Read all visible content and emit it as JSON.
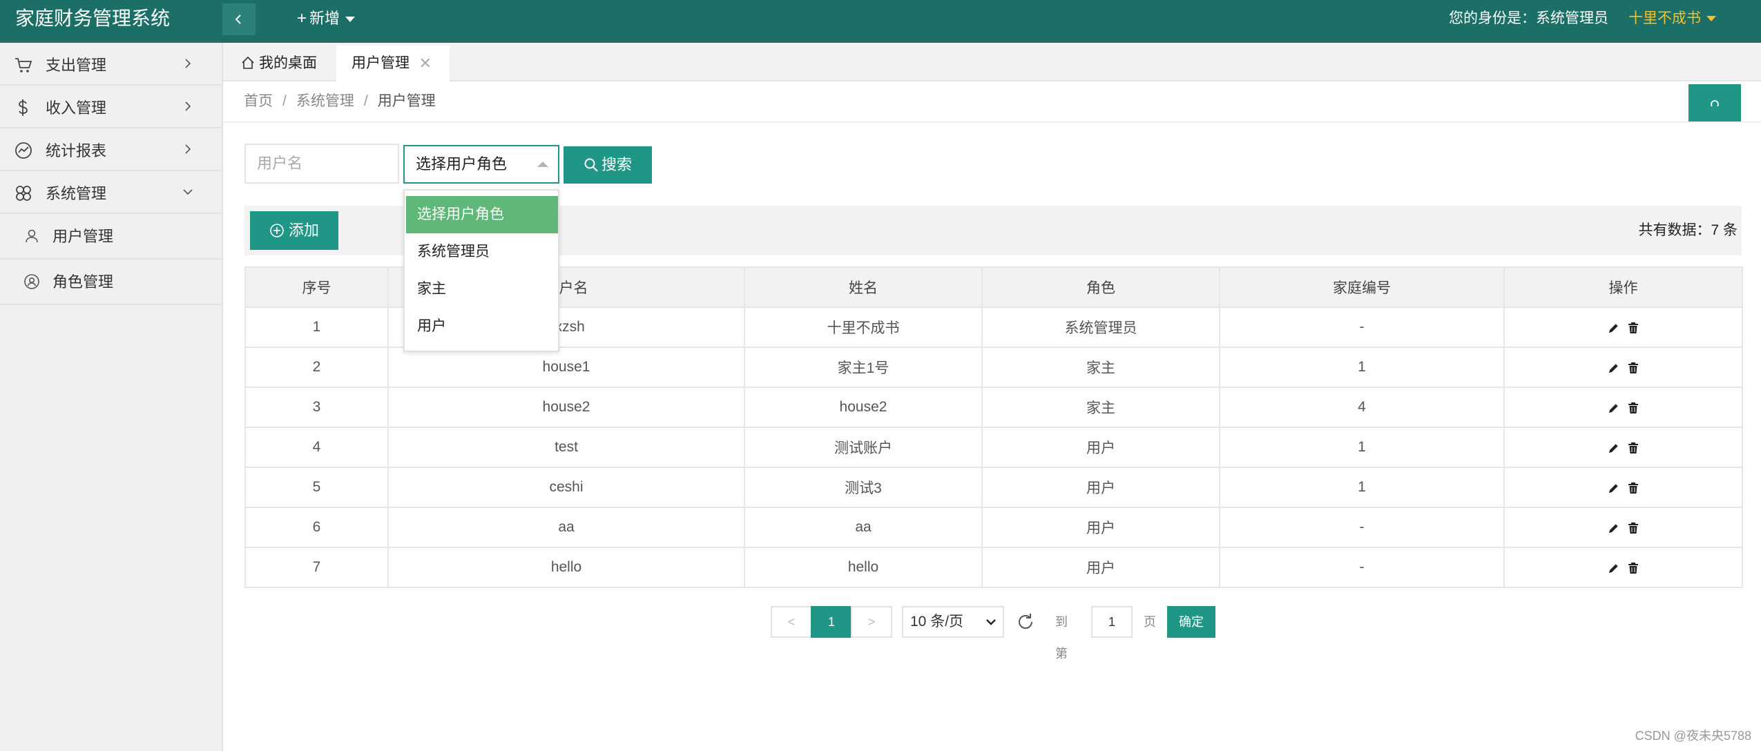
{
  "app": {
    "title": "家庭财务管理系统",
    "new_label": "新增",
    "identity_label": "您的身份是：系统管理员",
    "user_name": "十里不成书"
  },
  "colors": {
    "header": "#1c6f67",
    "accent": "#1f9686",
    "selected_option": "#5fb878",
    "user_name": "#f4c02e"
  },
  "sidebar": {
    "items": [
      {
        "label": "支出管理",
        "icon": "cart-icon",
        "expanded": false
      },
      {
        "label": "收入管理",
        "icon": "dollar-icon",
        "expanded": false
      },
      {
        "label": "统计报表",
        "icon": "chart-icon",
        "expanded": false
      },
      {
        "label": "系统管理",
        "icon": "clover-icon",
        "expanded": true
      }
    ],
    "sub_items": [
      {
        "label": "用户管理",
        "icon": "user-icon"
      },
      {
        "label": "角色管理",
        "icon": "role-icon"
      }
    ]
  },
  "tabs": [
    {
      "label": "我的桌面",
      "icon": "home-icon",
      "active": false
    },
    {
      "label": "用户管理",
      "active": true,
      "closable": true
    }
  ],
  "breadcrumb": {
    "items": [
      "首页",
      "系统管理",
      "用户管理"
    ],
    "separator": "/"
  },
  "search": {
    "username_placeholder": "用户名",
    "role_select_value": "选择用户角色",
    "role_options": [
      "选择用户角色",
      "系统管理员",
      "家主",
      "用户"
    ],
    "search_label": "搜索"
  },
  "toolbar": {
    "add_label": "添加",
    "total_label": "共有数据：7 条"
  },
  "table": {
    "columns": [
      "序号",
      "用户名",
      "姓名",
      "角色",
      "家庭编号",
      "操作"
    ],
    "rows": [
      [
        "1",
        "sxzsh",
        "十里不成书",
        "系统管理员",
        "-"
      ],
      [
        "2",
        "house1",
        "家主1号",
        "家主",
        "1"
      ],
      [
        "3",
        "house2",
        "house2",
        "家主",
        "4"
      ],
      [
        "4",
        "test",
        "测试账户",
        "用户",
        "1"
      ],
      [
        "5",
        "ceshi",
        "测试3",
        "用户",
        "1"
      ],
      [
        "6",
        "aa",
        "aa",
        "用户",
        "-"
      ],
      [
        "7",
        "hello",
        "hello",
        "用户",
        "-"
      ]
    ],
    "row_action_icons": [
      "edit-icon",
      "delete-icon"
    ]
  },
  "pagination": {
    "prev": "<",
    "current": "1",
    "next": ">",
    "page_size": "10 条/页",
    "goto_label": "到第",
    "goto_value": "1",
    "page_label": "页",
    "confirm_label": "确定"
  },
  "watermark": "CSDN @夜未央5788"
}
